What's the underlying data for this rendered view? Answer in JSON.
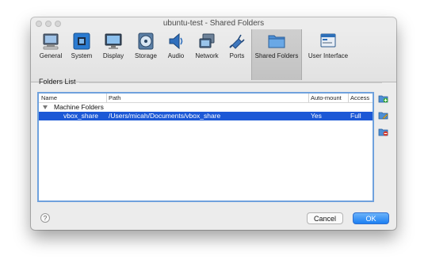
{
  "window": {
    "title": "ubuntu-test - Shared Folders"
  },
  "toolbar": {
    "items": [
      {
        "label": "General",
        "icon": "general-icon"
      },
      {
        "label": "System",
        "icon": "system-chip-icon"
      },
      {
        "label": "Display",
        "icon": "display-monitor-icon"
      },
      {
        "label": "Storage",
        "icon": "storage-disk-icon"
      },
      {
        "label": "Audio",
        "icon": "audio-speaker-icon"
      },
      {
        "label": "Network",
        "icon": "network-icon"
      },
      {
        "label": "Ports",
        "icon": "ports-plug-icon"
      },
      {
        "label": "Shared Folders",
        "icon": "shared-folder-icon",
        "active": true
      },
      {
        "label": "User Interface",
        "icon": "user-interface-icon"
      }
    ]
  },
  "folders": {
    "section_label": "Folders List",
    "columns": {
      "name": "Name",
      "path": "Path",
      "auto_mount": "Auto-mount",
      "access": "Access"
    },
    "group": {
      "label": "Machine Folders"
    },
    "rows": [
      {
        "name": "vbox_share",
        "path": "/Users/micah/Documents/vbox_share",
        "auto_mount": "Yes",
        "access": "Full"
      }
    ]
  },
  "side_buttons": [
    "add-shared-folder-icon",
    "edit-shared-folder-icon",
    "remove-shared-folder-icon"
  ],
  "footer": {
    "help": "?",
    "cancel": "Cancel",
    "ok": "OK"
  },
  "colors": {
    "selection": "#1c58d6",
    "ok_button": "#1b7ff2",
    "focus_border": "#6fa1dd"
  }
}
